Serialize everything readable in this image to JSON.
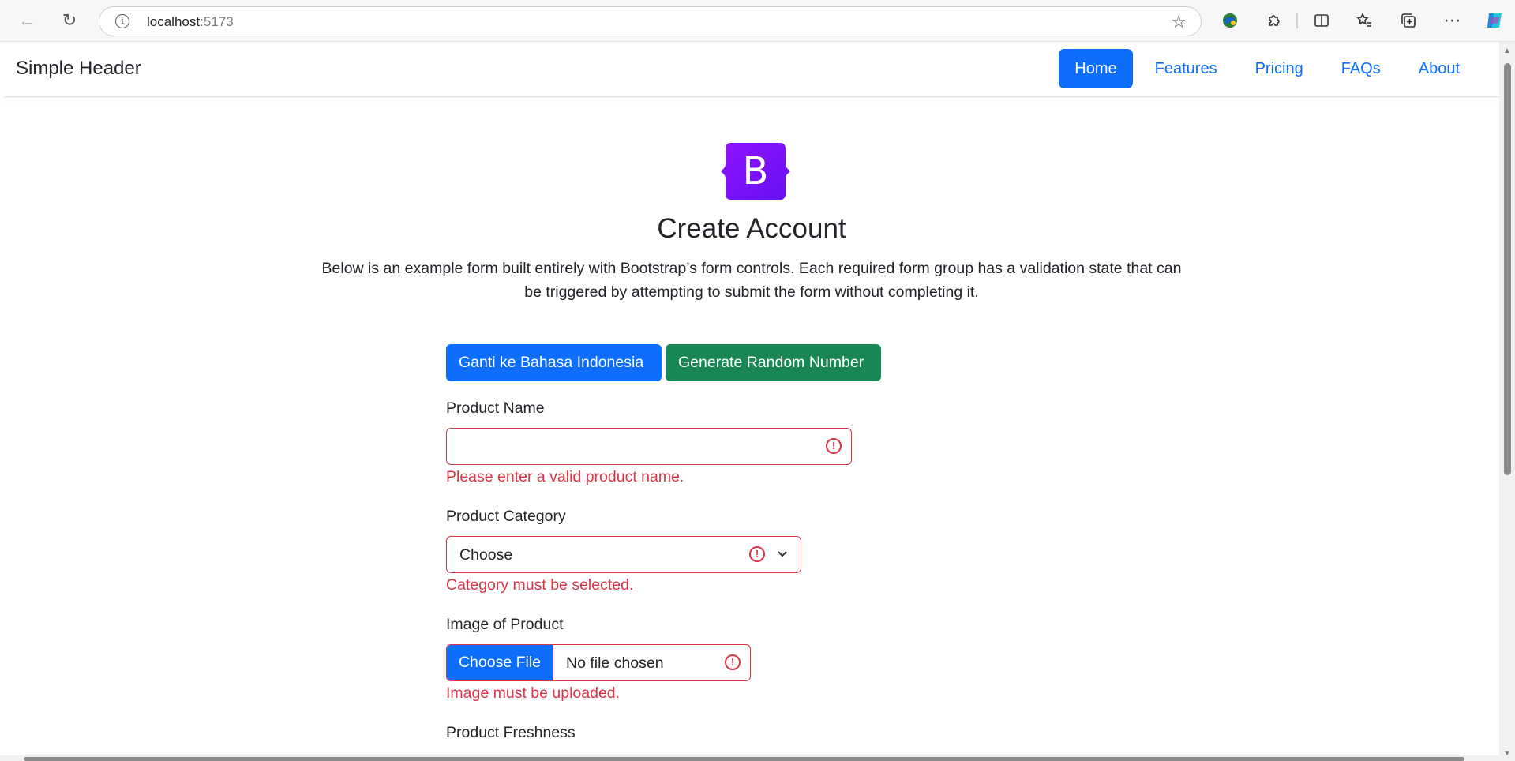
{
  "browser": {
    "url_host": "localhost",
    "url_port": ":5173"
  },
  "header": {
    "brand": "Simple Header",
    "nav": [
      {
        "label": "Home",
        "active": true
      },
      {
        "label": "Features",
        "active": false
      },
      {
        "label": "Pricing",
        "active": false
      },
      {
        "label": "FAQs",
        "active": false
      },
      {
        "label": "About",
        "active": false
      }
    ]
  },
  "hero": {
    "logo_letter": "B",
    "title": "Create Account",
    "description_line1": "Below is an example form built entirely with Bootstrap’s form controls. Each required form group has a validation state that can",
    "description_line2": "be triggered by attempting to submit the form without completing it."
  },
  "actions": {
    "language_button": "Ganti ke Bahasa Indonesia",
    "random_button": "Generate Random Number"
  },
  "form": {
    "product_name": {
      "label": "Product Name",
      "value": "",
      "error": "Please enter a valid product name."
    },
    "product_category": {
      "label": "Product Category",
      "selected": "Choose",
      "error": "Category must be selected."
    },
    "product_image": {
      "label": "Image of Product",
      "button": "Choose File",
      "status": "No file chosen",
      "error": "Image must be uploaded."
    },
    "product_freshness": {
      "label": "Product Freshness"
    }
  },
  "colors": {
    "primary": "#0d6efd",
    "success": "#198754",
    "danger": "#dc3545",
    "logo": "#7b1fe6"
  }
}
